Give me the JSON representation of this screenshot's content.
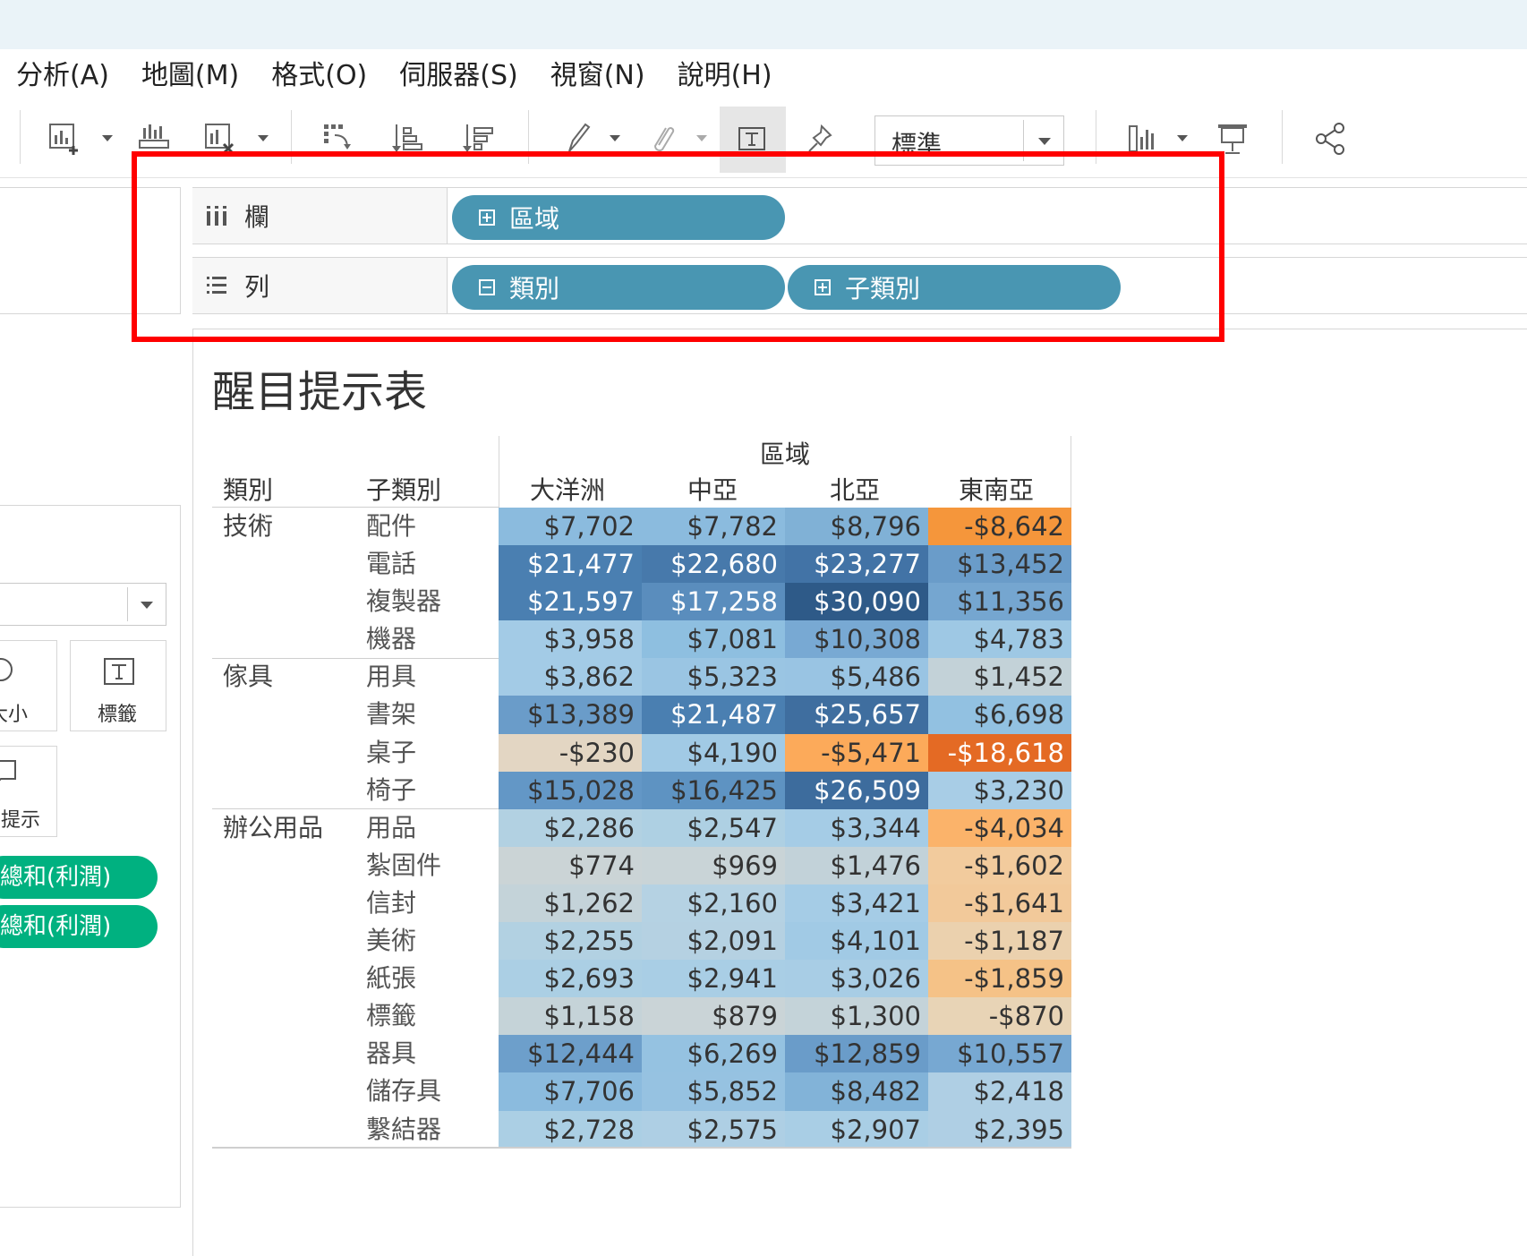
{
  "menu": [
    "分析(A)",
    "地圖(M)",
    "格式(O)",
    "伺服器(S)",
    "視窗(N)",
    "說明(H)"
  ],
  "toolbar": {
    "fit_value": "標準",
    "icons": [
      "new-worksheet-icon",
      "show-me-icon",
      "clear-sheet-icon",
      "swap-icon",
      "sort-ascending-icon",
      "sort-descending-icon",
      "highlight-icon",
      "group-icon",
      "show-labels-icon",
      "pin-icon",
      "fit-select",
      "show-cards-icon",
      "presentation-icon",
      "share-icon"
    ]
  },
  "left_panel": {
    "marks_size_label": "大小",
    "marks_label_label": "標籤",
    "marks_tooltip_label": "工具提示",
    "pills": [
      "總和(利潤)",
      "總和(利潤)"
    ]
  },
  "shelves": {
    "columns_label": "欄",
    "rows_label": "列",
    "columns_pills": [
      "區域"
    ],
    "rows_pills": [
      "類別",
      "子類別"
    ]
  },
  "view": {
    "title": "醒目提示表",
    "region_header": "區域",
    "category_header": "類別",
    "subcategory_header": "子類別",
    "regions": [
      "大洋洲",
      "中亞",
      "北亞",
      "東南亞"
    ]
  },
  "table": {
    "categories": [
      "技術",
      "傢具",
      "辦公用品"
    ],
    "rows": [
      {
        "category": "技術",
        "sub": "配件",
        "values": [
          "$7,702",
          "$7,782",
          "$8,796",
          "-$8,642"
        ],
        "colors": [
          "#8bbbde",
          "#8bbbde",
          "#80b1d6",
          "#f5963b"
        ]
      },
      {
        "category": "",
        "sub": "電話",
        "values": [
          "$21,477",
          "$22,680",
          "$23,277",
          "$13,452"
        ],
        "colors": [
          "#4a7fb1",
          "#4779ab",
          "#4273a6",
          "#6a9cc9"
        ]
      },
      {
        "category": "",
        "sub": "複製器",
        "values": [
          "$21,597",
          "$17,258",
          "$30,090",
          "$11,356"
        ],
        "colors": [
          "#4a7fb1",
          "#5a8dbd",
          "#2e5a88",
          "#75a6d0"
        ]
      },
      {
        "category": "",
        "sub": "機器",
        "values": [
          "$3,958",
          "$7,081",
          "$10,308",
          "$4,783"
        ],
        "colors": [
          "#a3cbe6",
          "#8ebfe0",
          "#78a9d3",
          "#9ec8e4"
        ]
      },
      {
        "category": "傢具",
        "sub": "用具",
        "values": [
          "$3,862",
          "$5,323",
          "$5,486",
          "$1,452"
        ],
        "colors": [
          "#a3cbe6",
          "#9ac5e3",
          "#99c4e3",
          "#c3d2d8"
        ]
      },
      {
        "category": "",
        "sub": "書架",
        "values": [
          "$13,389",
          "$21,487",
          "$25,657",
          "$6,698"
        ],
        "colors": [
          "#6a9cc9",
          "#4a7fb1",
          "#3f6e9f",
          "#92c1e1"
        ]
      },
      {
        "category": "",
        "sub": "桌子",
        "values": [
          "-$230",
          "$4,190",
          "-$5,471",
          "-$18,618"
        ],
        "colors": [
          "#e3d6c3",
          "#a1cae5",
          "#fcaa5a",
          "#e46a24"
        ]
      },
      {
        "category": "",
        "sub": "椅子",
        "values": [
          "$15,028",
          "$16,425",
          "$26,509",
          "$3,230"
        ],
        "colors": [
          "#6397c6",
          "#5e93c2",
          "#3d6c9d",
          "#a8cde6"
        ]
      },
      {
        "category": "辦公用品",
        "sub": "用品",
        "values": [
          "$2,286",
          "$2,547",
          "$3,344",
          "-$4,034"
        ],
        "colors": [
          "#b2d1e2",
          "#aed0e3",
          "#a5cce6",
          "#fbb36a"
        ]
      },
      {
        "category": "",
        "sub": "紮固件",
        "values": [
          "$774",
          "$969",
          "$1,476",
          "-$1,602"
        ],
        "colors": [
          "#cbd4d6",
          "#c9d4d7",
          "#c2d2d9",
          "#f2cb9d"
        ]
      },
      {
        "category": "",
        "sub": "信封",
        "values": [
          "$1,262",
          "$2,160",
          "$3,421",
          "-$1,641"
        ],
        "colors": [
          "#c4d3d9",
          "#b5d2e3",
          "#a5cce6",
          "#f2c99a"
        ]
      },
      {
        "category": "",
        "sub": "美術",
        "values": [
          "$2,255",
          "$2,091",
          "$4,101",
          "-$1,187"
        ],
        "colors": [
          "#b2d1e2",
          "#b5d1e2",
          "#a1cae5",
          "#ebd1ae"
        ]
      },
      {
        "category": "",
        "sub": "紙張",
        "values": [
          "$2,693",
          "$2,941",
          "$3,026",
          "-$1,859"
        ],
        "colors": [
          "#abcfe4",
          "#a9cee5",
          "#a8cde5",
          "#f5c287"
        ]
      },
      {
        "category": "",
        "sub": "標籤",
        "values": [
          "$1,158",
          "$879",
          "$1,300",
          "-$870"
        ],
        "colors": [
          "#c5d3d8",
          "#cad4d7",
          "#c4d3d9",
          "#e8d4b6"
        ]
      },
      {
        "category": "",
        "sub": "器具",
        "values": [
          "$12,444",
          "$6,269",
          "$12,859",
          "$10,557"
        ],
        "colors": [
          "#6d9fcb",
          "#95c2e1",
          "#6a9cc9",
          "#77a8d2"
        ]
      },
      {
        "category": "",
        "sub": "儲存具",
        "values": [
          "$7,706",
          "$5,852",
          "$8,482",
          "$2,418"
        ],
        "colors": [
          "#8bbbde",
          "#96c2e1",
          "#82b3d8",
          "#afcfe4"
        ]
      },
      {
        "category": "",
        "sub": "繫結器",
        "values": [
          "$2,728",
          "$2,575",
          "$2,907",
          "$2,395"
        ],
        "colors": [
          "#abcfe4",
          "#aecfe4",
          "#a9cee5",
          "#afcfe4"
        ]
      }
    ]
  }
}
